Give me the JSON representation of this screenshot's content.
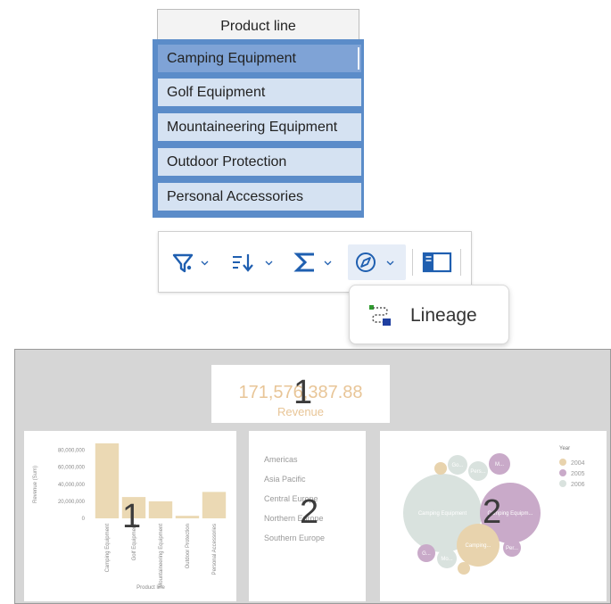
{
  "product_line": {
    "header": "Product line",
    "items": [
      {
        "label": "Camping Equipment",
        "selected": true
      },
      {
        "label": "Golf Equipment",
        "selected": false
      },
      {
        "label": "Mountaineering Equipment",
        "selected": false
      },
      {
        "label": "Outdoor Protection",
        "selected": false
      },
      {
        "label": "Personal Accessories",
        "selected": false
      }
    ]
  },
  "toolbar": {
    "buttons": [
      "filter-icon",
      "sort-icon",
      "summarize-icon",
      "explore-icon",
      "layout-icon"
    ]
  },
  "menu": {
    "items": [
      {
        "label": "Lineage",
        "icon": "lineage-icon"
      }
    ]
  },
  "dashboard": {
    "kpi": {
      "value": "171,576,387.88",
      "label": "Revenue",
      "overlay_number": "1"
    },
    "bar_card": {
      "overlay_number": "1"
    },
    "regions_card": {
      "overlay_number": "2",
      "regions": [
        "Americas",
        "Asia Pacific",
        "Central Europe",
        "Northern Europe",
        "Southern Europe"
      ]
    },
    "bubble_card": {
      "overlay_number": "2",
      "legend_title": "Year",
      "legend": [
        {
          "label": "2004",
          "color": "#e8d3ad"
        },
        {
          "label": "2005",
          "color": "#c9aac9"
        },
        {
          "label": "2006",
          "color": "#d9e2de"
        }
      ],
      "bubble_labels": [
        "Camping Equipment",
        "Camping Equipm...",
        "Camping...",
        "Go...",
        "Pers...",
        "M...",
        "G...",
        "Mo...",
        "Per..."
      ]
    },
    "colors": {
      "bar": "#ebd9b4",
      "kpi_text": "#e8c597",
      "gray_bg": "#d6d6d6"
    }
  },
  "chart_data": {
    "type": "bar",
    "categories": [
      "Camping Equipment",
      "Golf Equipment",
      "Mountaineering Equipment",
      "Outdoor Protection",
      "Personal Accessories"
    ],
    "values": [
      88000000,
      25000000,
      20000000,
      3000000,
      31000000
    ],
    "title": "",
    "xlabel": "Product line",
    "ylabel": "Revenue (Sum)",
    "yticks": [
      "80,000,000",
      "60,000,000",
      "40,000,000",
      "20,000,000",
      "0"
    ],
    "ylim": [
      0,
      90000000
    ],
    "grid": false
  }
}
